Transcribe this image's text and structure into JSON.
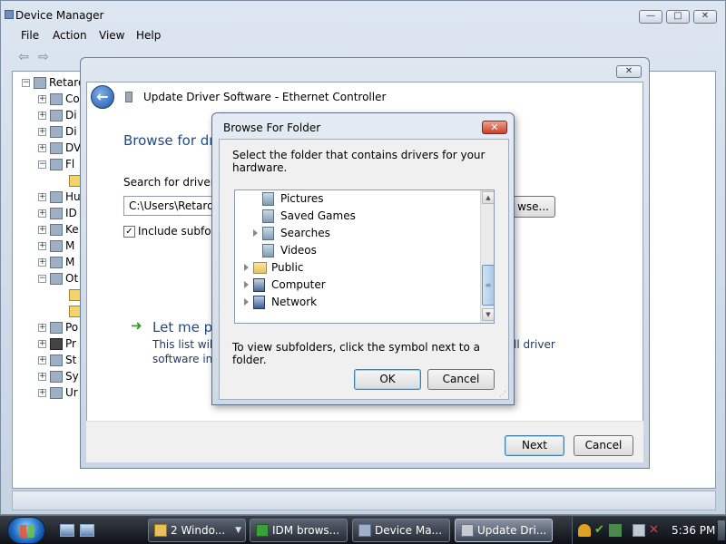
{
  "device_manager": {
    "title": "Device Manager",
    "menu": [
      "File",
      "Action",
      "View",
      "Help"
    ],
    "tree": [
      {
        "label": "Retard",
        "expander": "−"
      },
      {
        "label": "Co",
        "expander": "+"
      },
      {
        "label": "Di",
        "expander": "+"
      },
      {
        "label": "Di",
        "expander": "+"
      },
      {
        "label": "DV",
        "expander": "+"
      },
      {
        "label": "Fl",
        "expander": "−"
      },
      {
        "label": "",
        "expander": ""
      },
      {
        "label": "Hu",
        "expander": "+"
      },
      {
        "label": "ID",
        "expander": "+"
      },
      {
        "label": "Ke",
        "expander": "+"
      },
      {
        "label": "M",
        "expander": "+"
      },
      {
        "label": "M",
        "expander": "+"
      },
      {
        "label": "Ot",
        "expander": "−"
      },
      {
        "label": "",
        "expander": ""
      },
      {
        "label": "",
        "expander": ""
      },
      {
        "label": "Po",
        "expander": "+"
      },
      {
        "label": "Pr",
        "expander": "+"
      },
      {
        "label": "St",
        "expander": "+"
      },
      {
        "label": "Sy",
        "expander": "+"
      },
      {
        "label": "Ur",
        "expander": "+"
      }
    ]
  },
  "wizard": {
    "title": "Update Driver Software - Ethernet Controller",
    "heading": "Browse for dri",
    "search_label": "Search for driver so",
    "path_value": "C:\\Users\\Retardac",
    "browse_label": "wse...",
    "include_subfolders_label": "Include subfold",
    "include_subfolders_checked": "✓",
    "let_me_pick": "Let me pi",
    "desc_line1": "This list will s",
    "desc_line2": "software in t",
    "desc_tail": "ll driver",
    "next_label": "Next",
    "cancel_label": "Cancel"
  },
  "browse_folder": {
    "title": "Browse For Folder",
    "instruction": "Select the folder that contains drivers for your hardware.",
    "items": [
      {
        "label": "Pictures",
        "icon": "pictures-folder-icon"
      },
      {
        "label": "Saved Games",
        "icon": "saved-games-icon"
      },
      {
        "label": "Searches",
        "icon": "searches-folder-icon"
      },
      {
        "label": "Videos",
        "icon": "videos-folder-icon"
      },
      {
        "label": "Public",
        "icon": "folder-icon"
      },
      {
        "label": "Computer",
        "icon": "computer-icon"
      },
      {
        "label": "Network",
        "icon": "network-icon"
      }
    ],
    "hint": "To view subfolders, click the symbol next to a folder.",
    "ok_label": "OK",
    "cancel_label": "Cancel",
    "close_symbol": "✕"
  },
  "taskbar": {
    "tasks": [
      {
        "label": "2 Windo...",
        "icon": "folder-icon"
      },
      {
        "label": "IDM brows...",
        "icon": "idm-icon"
      },
      {
        "label": "Device Ma...",
        "icon": "device-manager-icon"
      },
      {
        "label": "Update Dri...",
        "icon": "update-driver-icon"
      }
    ],
    "clock": "5:36 PM"
  },
  "colors": {
    "heading_blue": "#1f4a8a",
    "close_red": "#c8412a",
    "taskbar_dark": "#0d1117"
  }
}
